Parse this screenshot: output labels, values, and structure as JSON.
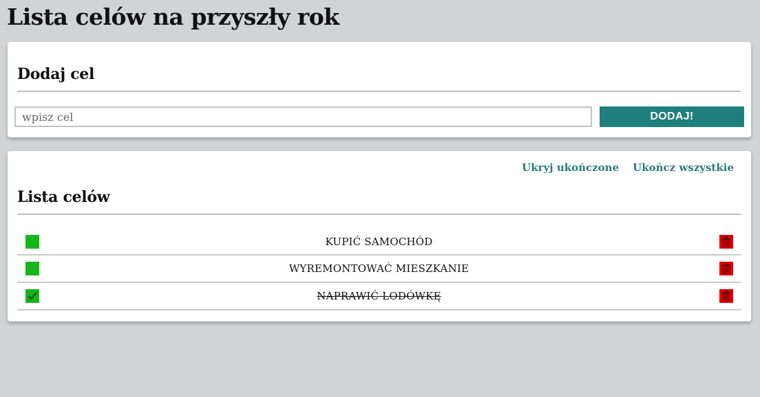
{
  "page": {
    "title": "Lista celów na przyszły rok"
  },
  "add_section": {
    "title": "Dodaj cel",
    "input_placeholder": "wpisz cel",
    "input_value": "",
    "button_label": "DODAJ!"
  },
  "list_section": {
    "hide_completed_label": "Ukryj ukończone",
    "complete_all_label": "Ukończ wszystkie",
    "title": "Lista celów",
    "goals": [
      {
        "text": "KUPIĆ SAMOCHÓD",
        "done": false
      },
      {
        "text": "WYREMONTOWAĆ MIESZKANIE",
        "done": false
      },
      {
        "text": "NAPRAWIĆ LODÓWKĘ",
        "done": true
      }
    ]
  },
  "colors": {
    "background": "#d1d4d5",
    "accent": "#1f7f7c",
    "link": "#2a7c7e",
    "checkbox": "#16b51a",
    "delete": "#e00000"
  },
  "icons": {
    "check": "checkmark-icon",
    "delete": "trash-icon"
  }
}
